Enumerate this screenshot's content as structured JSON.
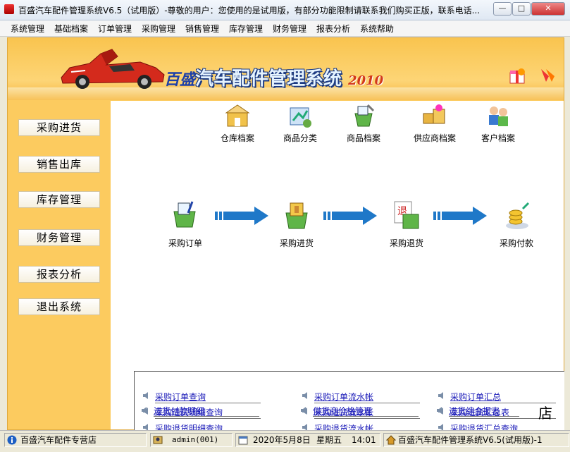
{
  "window": {
    "title": "百盛汽车配件管理系统V6.5（试用版）-尊敬的用户：您使用的是试用版，有部分功能限制请联系我们购买正版，联系电话...",
    "minimize_label": "—",
    "restore_label": "□",
    "close_label": "✕"
  },
  "menu": [
    "系统管理",
    "基础档案",
    "订单管理",
    "采购管理",
    "销售管理",
    "库存管理",
    "财务管理",
    "报表分析",
    "系统帮助"
  ],
  "banner": {
    "brand_prefix": "百盛",
    "brand_name": "汽车配件管理系统",
    "brand_year": "2010"
  },
  "sidebar": [
    "采购进货",
    "销售出库",
    "库存管理",
    "财务管理",
    "报表分析",
    "退出系统"
  ],
  "archive_icons": [
    {
      "label": "仓库档案",
      "icon": "warehouse-icon"
    },
    {
      "label": "商品分类",
      "icon": "category-icon"
    },
    {
      "label": "商品档案",
      "icon": "goods-icon"
    },
    {
      "label": "供应商档案",
      "icon": "supplier-icon"
    },
    {
      "label": "客户档案",
      "icon": "customer-icon"
    }
  ],
  "flow": [
    {
      "label": "采购订单",
      "icon": "purchase-order-icon"
    },
    {
      "label": "采购进货",
      "icon": "purchase-in-icon"
    },
    {
      "label": "采购退货",
      "icon": "purchase-return-icon"
    },
    {
      "label": "采购付款",
      "icon": "purchase-payment-icon"
    }
  ],
  "links": {
    "col1": [
      "采购订单查询",
      "采购进货明细查询",
      "采购退货明细查询",
      "进货付款明细"
    ],
    "col2": [
      "采购订单流水帐",
      "采购进货流水帐",
      "采购退货流水帐",
      "供货商价格管理"
    ],
    "col3": [
      "采购订单汇总",
      "采购进货汇总表",
      "采购退货汇总查询",
      "进货综合报表"
    ]
  },
  "overflow_char": "店",
  "status": {
    "store": "百盛汽车配件专营店",
    "user": "admin(001)",
    "date": "2020年5月8日",
    "weekday": "星期五",
    "time": "14:01",
    "app": "百盛汽车配件管理系统V6.5(试用版)-1"
  },
  "colors": {
    "banner": "#fccb5f",
    "content_bg": "#ffffff",
    "link": "#1a1ab8",
    "arrow": "#1f78c8"
  }
}
